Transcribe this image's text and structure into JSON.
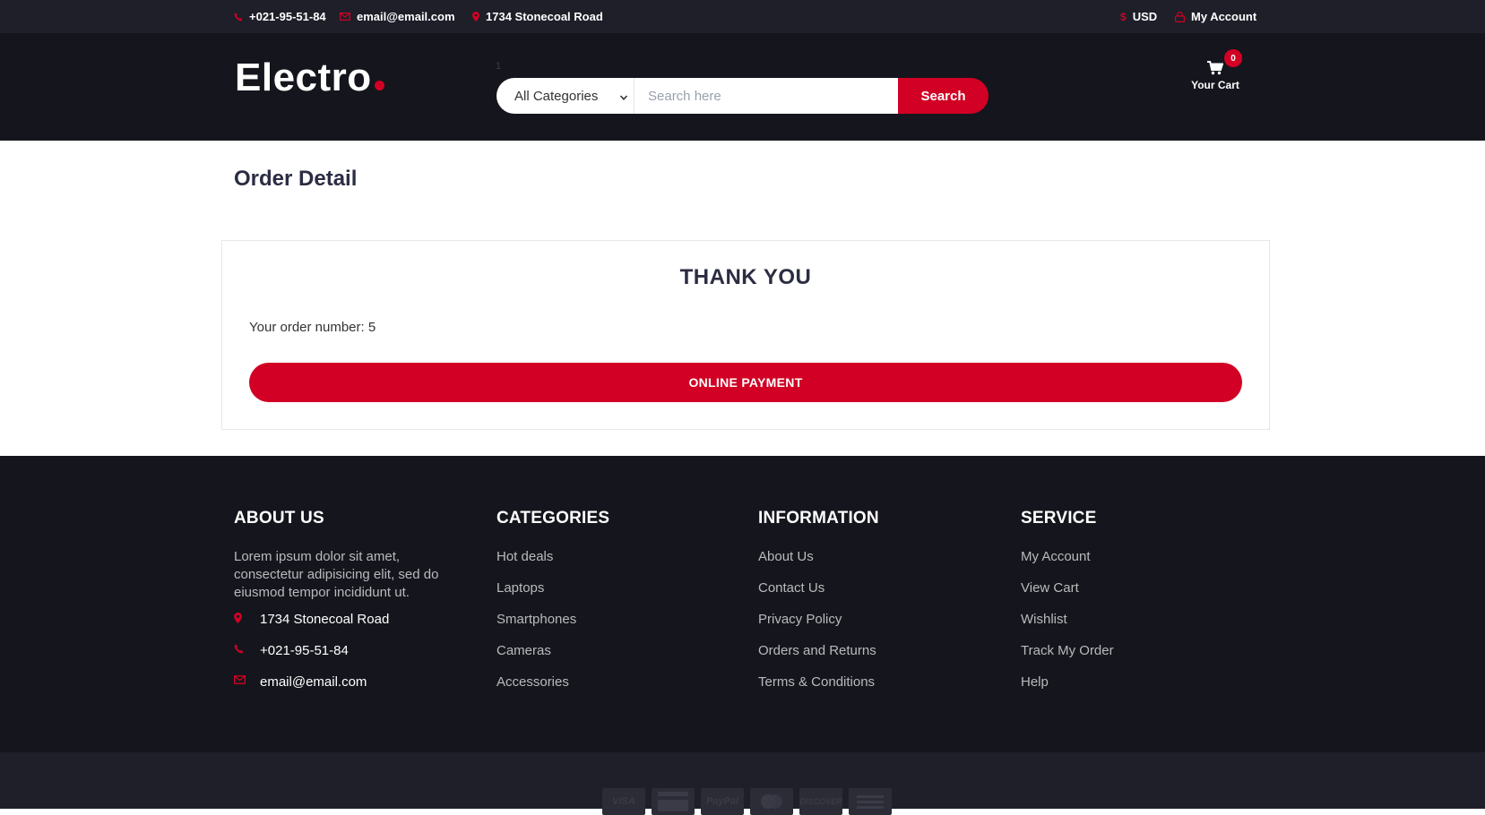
{
  "topbar": {
    "phone": "+021-95-51-84",
    "email": "email@email.com",
    "address": "1734 Stonecoal Road",
    "currency": "USD",
    "account": "My Account"
  },
  "header": {
    "logo_text": "Electro",
    "stray_text": "1",
    "category_select": "All Categories",
    "search_placeholder": "Search here",
    "search_button": "Search",
    "cart_label": "Your Cart",
    "cart_count": "0"
  },
  "main": {
    "title": "Order Detail",
    "thank_you": "THANK YOU",
    "order_number": "Your order number: 5",
    "payment_button": "ONLINE PAYMENT"
  },
  "footer": {
    "about": {
      "title": "ABOUT US",
      "text": "Lorem ipsum dolor sit amet, consectetur adipisicing elit, sed do eiusmod tempor incididunt ut.",
      "address": "1734 Stonecoal Road",
      "phone": "+021-95-51-84",
      "email": "email@email.com"
    },
    "categories": {
      "title": "CATEGORIES",
      "items": [
        "Hot deals",
        "Laptops",
        "Smartphones",
        "Cameras",
        "Accessories"
      ]
    },
    "information": {
      "title": "INFORMATION",
      "items": [
        "About Us",
        "Contact Us",
        "Privacy Policy",
        "Orders and Returns",
        "Terms & Conditions"
      ]
    },
    "service": {
      "title": "SERVICE",
      "items": [
        "My Account",
        "View Cart",
        "Wishlist",
        "Track My Order",
        "Help"
      ]
    },
    "payment_icons": [
      "VISA",
      "credit-card",
      "PayPal",
      "mastercard",
      "DISCOVER",
      "amex"
    ]
  },
  "colors": {
    "accent": "#D10024",
    "topbar_bg": "#1e1f29",
    "header_bg": "#15161d",
    "text_dark": "#2b2d42"
  }
}
